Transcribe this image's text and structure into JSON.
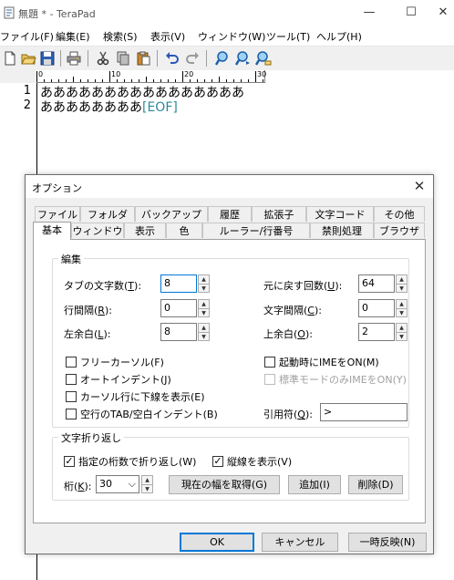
{
  "window": {
    "title": "無題 * - TeraPad",
    "minimize_glyph": "—",
    "maximize_glyph": "☐",
    "close_glyph": "✕"
  },
  "menubar": [
    "ファイル(F)",
    "編集(E)",
    "検索(S)",
    "表示(V)",
    "ウィンドウ(W)",
    "ツール(T)",
    "ヘルプ(H)"
  ],
  "ruler": {
    "labels": [
      "0",
      "10",
      "20",
      "30"
    ]
  },
  "editor": {
    "line_numbers": [
      "1",
      "2"
    ],
    "lines": [
      "ああああああああああああああああ",
      "ああああああああ"
    ],
    "eof_marker": "[EOF]"
  },
  "dialog": {
    "title": "オプション",
    "close_glyph": "✕",
    "tabs_back": [
      "ファイル",
      "フォルダ",
      "バックアップ",
      "履歴",
      "拡張子",
      "文字コード",
      "その他"
    ],
    "tabs_front": [
      "基本",
      "ウィンドウ",
      "表示",
      "色",
      "ルーラー/行番号",
      "禁則処理",
      "ブラウザ"
    ],
    "active_tab": "基本",
    "edit_group": {
      "label": "編集",
      "tab_width": {
        "label": "タブの文字数(",
        "key": "T",
        "suffix": "):",
        "value": "8"
      },
      "line_spacing": {
        "label": "行間隔(",
        "key": "R",
        "suffix": "):",
        "value": "0"
      },
      "left_margin": {
        "label": "左余白(",
        "key": "L",
        "suffix": "):",
        "value": "8"
      },
      "undo_count": {
        "label": "元に戻す回数(",
        "key": "U",
        "suffix": "):",
        "value": "64"
      },
      "char_spacing": {
        "label": "文字間隔(",
        "key": "C",
        "suffix": "):",
        "value": "0"
      },
      "top_margin": {
        "label": "上余白(",
        "key": "O",
        "suffix": "):",
        "value": "2"
      },
      "checkboxes": [
        {
          "label": "フリーカーソル(F)",
          "checked": false
        },
        {
          "label": "オートインデント(J)",
          "checked": false
        },
        {
          "label": "カーソル行に下線を表示(E)",
          "checked": false
        },
        {
          "label": "空行のTAB/空白インデント(B)",
          "checked": false
        },
        {
          "label": "起動時にIMEをON(M)",
          "checked": false
        },
        {
          "label": "標準モードのみIMEをON(Y)",
          "checked": false,
          "disabled": true
        }
      ],
      "quote": {
        "label": "引用符(",
        "key": "Q",
        "suffix": "):",
        "value": ">"
      }
    },
    "wrap_group": {
      "label": "文字折り返し",
      "wrap_checkbox": {
        "label": "指定の桁数で折り返し(W)",
        "checked": true
      },
      "show_vline_checkbox": {
        "label": "縦線を表示(V)",
        "checked": true
      },
      "column": {
        "label": "桁(",
        "key": "K",
        "suffix": "):",
        "value": "30"
      },
      "get_width_button": "現在の幅を取得(G)",
      "add_button": "追加(I)",
      "delete_button": "削除(D)"
    },
    "buttons": {
      "ok": "OK",
      "cancel": "キャンセル",
      "apply": "一時反映(N)"
    },
    "check_glyph": "✓",
    "spin_up": "▲",
    "spin_down": "▼",
    "dropdown_glyph": "⌵"
  }
}
